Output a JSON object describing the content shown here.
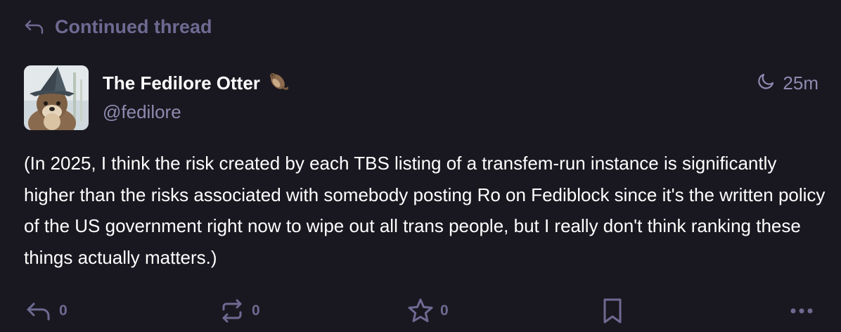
{
  "prepend": {
    "label": "Continued thread",
    "icon": "reply-icon"
  },
  "account": {
    "display_name": "The Fedilore Otter",
    "emoji": "🦦",
    "handle": "@fedilore"
  },
  "meta": {
    "visibility_icon": "moon-icon",
    "time": "25m"
  },
  "content": {
    "text": "(In 2025, I think the risk created by each TBS listing of a transfem-run instance is significantly higher than the risks associated with somebody posting Ro on Fediblock since it's the written policy of the US government right now to wipe out all trans people, but I really don't think ranking these things actually matters.)"
  },
  "actions": {
    "reply_count": "0",
    "boost_count": "0",
    "favourite_count": "0"
  },
  "colors": {
    "background": "#191820",
    "muted": "#6e6a92",
    "secondary": "#8e8ab0",
    "text": "#ffffff"
  }
}
